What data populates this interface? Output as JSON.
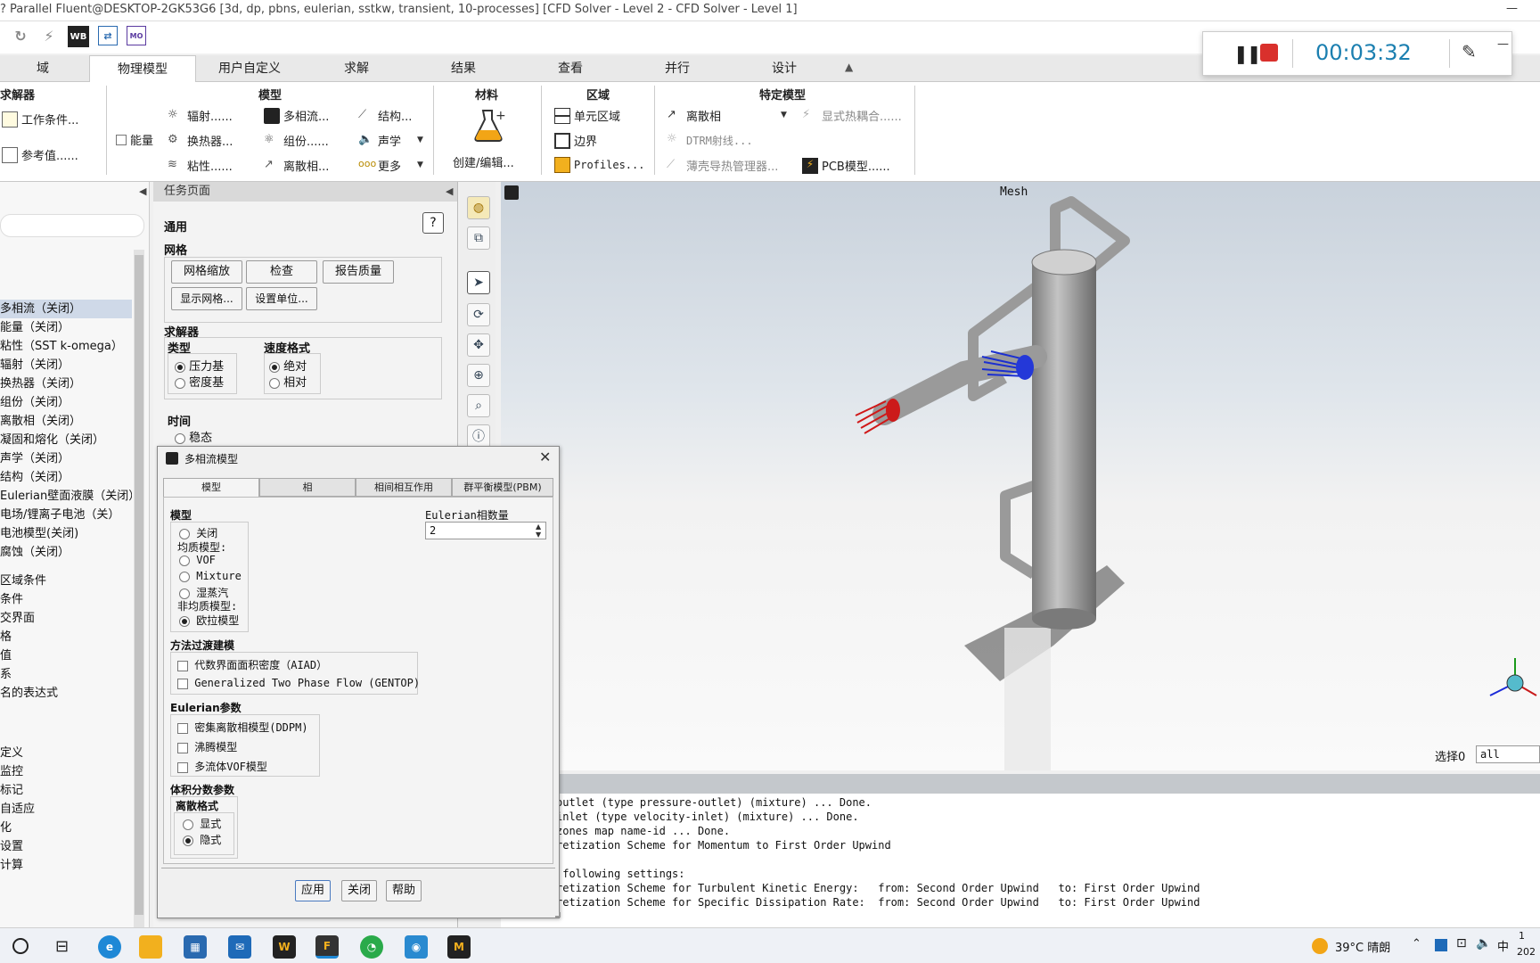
{
  "window": {
    "title": "? Parallel Fluent@DESKTOP-2GK53G6  [3d, dp, pbns, eulerian, sstkw, transient, 10-processes] [CFD Solver - Level 2 - CFD Solver - Level 1]",
    "minimize": "—"
  },
  "quickbar": {
    "wb_label": "WB",
    "mo_label": "MO"
  },
  "recorder": {
    "timer": "00:03:32",
    "minimize": "—"
  },
  "ribbon_tabs": [
    "域",
    "物理模型",
    "用户自定义",
    "求解",
    "结果",
    "查看",
    "并行",
    "设计"
  ],
  "ribbon": {
    "solver_group": {
      "title": "求解器",
      "working_conditions": "工作条件...",
      "reference_values": "参考值......"
    },
    "energy_label": "能量",
    "models_group": {
      "title": "模型",
      "radiation": "辐射......",
      "heat_exchanger": "换热器...",
      "viscous": "粘性......",
      "multiphase": "多相流...",
      "species": "组份......",
      "dpm": "离散相...",
      "structure": "结构...",
      "acoustics": "声学",
      "more": "更多"
    },
    "materials_group": {
      "title": "材料",
      "create_edit": "创建/编辑..."
    },
    "zones_group": {
      "title": "区域",
      "cell_zones": "单元区域",
      "boundaries": "边界",
      "profiles": "Profiles..."
    },
    "specialized_group": {
      "title": "特定模型",
      "discrete_phase": "离散相",
      "dtrm": "DTRM射线...",
      "shell_conduction": "薄壳导热管理器...",
      "thermal_coupling": "显式热耦合......",
      "pcb": "PCB模型......"
    }
  },
  "tree": {
    "items": [
      "多相流（关闭）",
      "能量（关闭）",
      "粘性（SST k-omega）",
      "辐射（关闭）",
      "换热器（关闭）",
      "组份（关闭）",
      "离散相（关闭）",
      "凝固和熔化（关闭）",
      "声学（关闭）",
      "结构（关闭）",
      "Eulerian壁面液膜（关闭）",
      "电场/锂离子电池（关）",
      "电池模型(关闭)",
      "腐蚀（关闭）"
    ],
    "items2": [
      "区域条件",
      "条件",
      "交界面",
      "格",
      "值",
      "系",
      "名的表达式"
    ],
    "items3": [
      "定义",
      "监控",
      "标记",
      "自适应",
      "化",
      "设置",
      "计算"
    ]
  },
  "task_page": {
    "title": "任务页面",
    "section": "通用",
    "mesh_label": "网格",
    "mesh_buttons": [
      "网格缩放",
      "检查",
      "报告质量",
      "显示网格...",
      "设置单位..."
    ],
    "solver_label": "求解器",
    "type_label": "类型",
    "type_options": [
      "压力基",
      "密度基"
    ],
    "velocity_label": "速度格式",
    "velocity_options": [
      "绝对",
      "相对"
    ],
    "time_label": "时间",
    "time_option": "稳态"
  },
  "viewport": {
    "title": "Mesh",
    "select_label": "选择0",
    "select_value": "all"
  },
  "console": {
    "lines": [
      "outlet (type pressure-outlet) (mixture) ... Done.",
      "inlet (type velocity-inlet) (mixture) ... Done.",
      "zones map name-id ... Done.",
      "retization Scheme for Momentum to First Order Upwind",
      "",
      " following settings:",
      "retization Scheme for Turbulent Kinetic Energy:   from: Second Order Upwind   to: First Order Upwind",
      "retization Scheme for Specific Dissipation Rate:  from: Second Order Upwind   to: First Order Upwind"
    ]
  },
  "dialog": {
    "title": "多相流模型",
    "tabs": [
      "模型",
      "相",
      "相间相互作用",
      "群平衡模型(PBM)"
    ],
    "model_label": "模型",
    "model_off": "关闭",
    "homogeneous_label": "均质模型:",
    "vof": "VOF",
    "mixture": "Mixture",
    "wet_steam": "湿蒸汽",
    "inhomogeneous_label": "非均质模型:",
    "eulerian": "欧拉模型",
    "phase_count_label": "Eulerian相数量",
    "phase_count": "2",
    "transition_label": "方法过渡建模",
    "aiad": "代数界面面积密度（AIAD）",
    "gentop": "Generalized Two Phase Flow (GENTOP)",
    "eulerian_params_label": "Eulerian参数",
    "ddpm": "密集离散相模型(DDPM)",
    "boiling": "沸腾模型",
    "multifluid_vof": "多流体VOF模型",
    "vf_params_label": "体积分数参数",
    "scheme_label": "离散格式",
    "explicit": "显式",
    "implicit": "隐式",
    "apply": "应用",
    "close": "关闭",
    "help": "帮助"
  },
  "taskbar": {
    "weather": "39°C  晴朗",
    "ime": "中",
    "clock_a": "1",
    "clock_b": "202"
  },
  "colors": {
    "accent": "#1a73b8",
    "timer": "#1b7fb0",
    "stop": "#d9302c"
  }
}
